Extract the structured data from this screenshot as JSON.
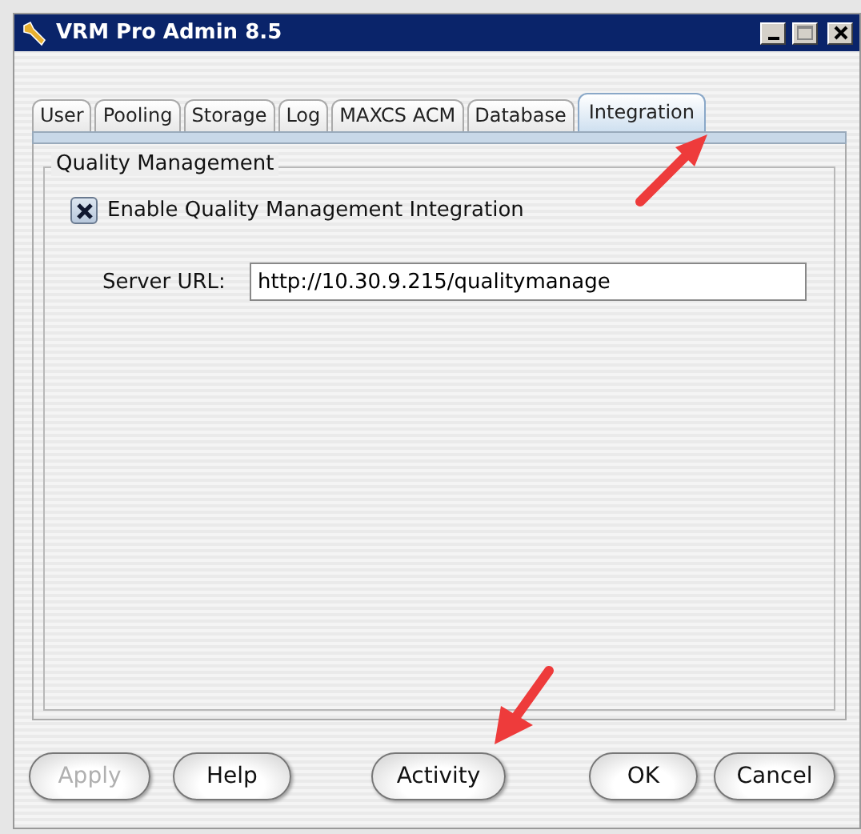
{
  "window": {
    "title": "VRM Pro Admin 8.5"
  },
  "tabs": [
    {
      "label": "User",
      "selected": false
    },
    {
      "label": "Pooling",
      "selected": false
    },
    {
      "label": "Storage",
      "selected": false
    },
    {
      "label": "Log",
      "selected": false
    },
    {
      "label": "MAXCS ACM",
      "selected": false
    },
    {
      "label": "Database",
      "selected": false
    },
    {
      "label": "Integration",
      "selected": true
    }
  ],
  "group": {
    "title": "Quality Management",
    "checkbox": {
      "label": "Enable Quality Management Integration",
      "checked": true
    },
    "server_url": {
      "label": "Server URL:",
      "value": "http://10.30.9.215/qualitymanage"
    }
  },
  "buttons": [
    {
      "label": "Apply",
      "disabled": true
    },
    {
      "label": "Help",
      "disabled": false
    },
    {
      "label": "Activity",
      "disabled": false
    },
    {
      "label": "OK",
      "disabled": false
    },
    {
      "label": "Cancel",
      "disabled": false
    }
  ]
}
